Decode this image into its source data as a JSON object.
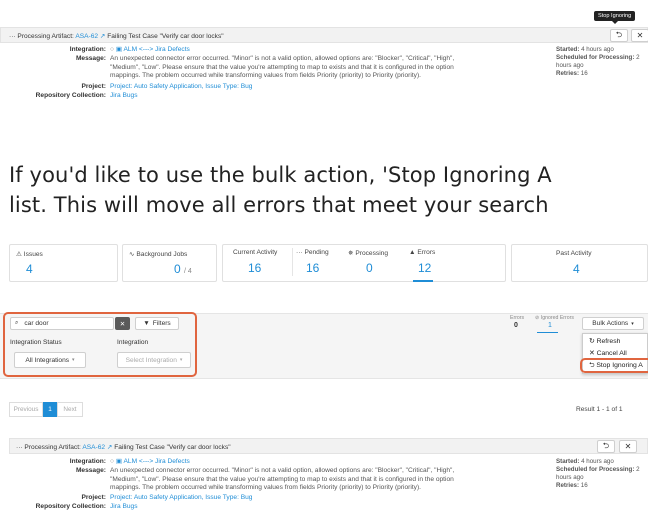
{
  "tooltip": "Stop Ignoring",
  "artifact_top": {
    "prefix": "··· Processing Artifact:",
    "artifact_id": "ASA-62",
    "title": "Failing Test Case \"Verify car door locks\"",
    "labels": {
      "integration": "Integration:",
      "message": "Message:",
      "project": "Project:",
      "repository": "Repository Collection:"
    },
    "integration": "ALM <---> Jira Defects",
    "message_lines": [
      "An unexpected connector error occurred. \"Minor\" is not a valid option, allowed options are: \"Blocker\", \"Critical\", \"High\",",
      "\"Medium\", \"Low\". Please ensure that the value you're attempting to map to exists and that it is configured in the option",
      "mappings. The problem occurred while transforming values from fields Priority (priority) to Priority (priority)."
    ],
    "project": "Project: Auto Safety Application, Issue Type: Bug",
    "repository": "Jira Bugs",
    "started_label": "Started:",
    "started": "4 hours ago",
    "scheduled_label": "Scheduled for Processing:",
    "scheduled_value_a": "2",
    "scheduled_value_b": "hours ago",
    "retries_label": "Retries:",
    "retries": "16"
  },
  "instruction_lines": [
    "If you'd like to use the bulk action, 'Stop Ignoring A",
    "list.  This will move all errors that meet your search"
  ],
  "stats": {
    "issues": {
      "label": "Issues",
      "value": "4"
    },
    "background_jobs": {
      "label": "Background Jobs",
      "value": "0",
      "denom": "/ 4"
    },
    "current_activity": {
      "label": "Current Activity",
      "value": "16"
    },
    "pending": {
      "label": "Pending",
      "value": "16"
    },
    "processing": {
      "label": "Processing",
      "value": "0"
    },
    "errors": {
      "label": "Errors",
      "value": "12"
    },
    "past_activity": {
      "label": "Past Activity",
      "value": "4"
    }
  },
  "filters": {
    "search_value": "car door",
    "filters_button": "Filters",
    "integration_status_label": "Integration Status",
    "integration_status_value": "All Integrations",
    "integration_label": "Integration",
    "integration_placeholder": "Select Integration",
    "errors_small_label": "Errors",
    "errors_small_value": "0",
    "ignored_errors_label": "Ignored Errors",
    "ignored_errors_value": "1",
    "bulk_actions": "Bulk Actions"
  },
  "bulk_menu": [
    "Refresh",
    "Cancel All",
    "Stop Ignoring A"
  ],
  "pagination": {
    "previous": "Previous",
    "current": "1",
    "next": "Next",
    "result": "Result 1 - 1 of 1"
  },
  "colors": {
    "link": "#1f8dd6",
    "highlight": "#e0653f",
    "tooltip_bg": "#222222"
  }
}
